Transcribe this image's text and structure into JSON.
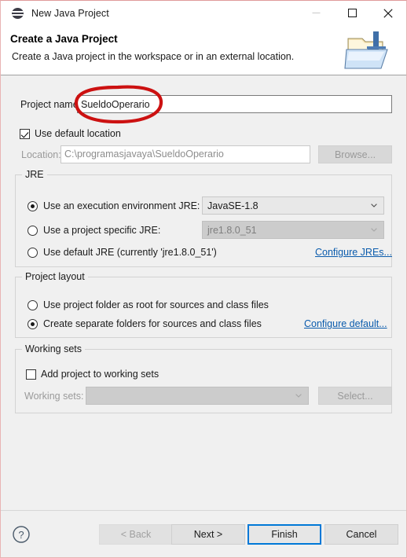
{
  "window": {
    "title": "New Java Project",
    "icon": "eclipse-globe-icon",
    "controls": {
      "minimize": "minimize-icon",
      "maximize": "maximize-icon",
      "close": "close-icon"
    }
  },
  "header": {
    "title": "Create a Java Project",
    "subtitle": "Create a Java project in the workspace or in an external location.",
    "icon": "java-project-folder-icon"
  },
  "form": {
    "project_name_label": "Project name:",
    "project_name_value": "SueldoOperario",
    "use_default_location_label": "Use default location",
    "use_default_location_checked": true,
    "location_label": "Location:",
    "location_value": "C:\\programasjavaya\\SueldoOperario",
    "browse_label": "Browse..."
  },
  "jre": {
    "group_title": "JRE",
    "options": [
      {
        "label": "Use an execution environment JRE:",
        "selected": true
      },
      {
        "label": "Use a project specific JRE:",
        "selected": false
      },
      {
        "label": "Use default JRE (currently 'jre1.8.0_51')",
        "selected": false
      }
    ],
    "execution_env_value": "JavaSE-1.8",
    "specific_jre_value": "jre1.8.0_51",
    "configure_link": "Configure JREs..."
  },
  "project_layout": {
    "group_title": "Project layout",
    "options": [
      {
        "label": "Use project folder as root for sources and class files",
        "selected": false
      },
      {
        "label": "Create separate folders for sources and class files",
        "selected": true
      }
    ],
    "configure_link": "Configure default..."
  },
  "working_sets": {
    "group_title": "Working sets",
    "add_label": "Add project to working sets",
    "add_checked": false,
    "sets_label": "Working sets:",
    "sets_value": "",
    "select_label": "Select..."
  },
  "footer": {
    "help": "help-icon",
    "back_label": "< Back",
    "next_label": "Next >",
    "finish_label": "Finish",
    "cancel_label": "Cancel"
  },
  "annotation": {
    "shape": "red-ellipse-highlight",
    "color": "#cc1111",
    "targets": "project_name_value"
  },
  "colors": {
    "accent": "#0078d7",
    "link": "#0b5cad",
    "annotation": "#cc1111",
    "body_bg": "#f0f0f0",
    "header_bg": "#ffffff"
  }
}
